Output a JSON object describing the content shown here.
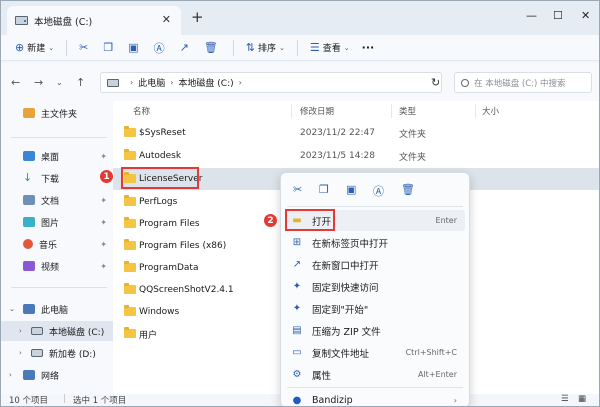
{
  "tab": {
    "title": "本地磁盘 (C:)",
    "close": "✕",
    "add": "+"
  },
  "window_controls": {
    "minimize": "—",
    "maximize": "☐",
    "close": "✕"
  },
  "toolbar": {
    "new_label": "新建",
    "sort_label": "排序",
    "view_label": "查看",
    "more_label": "···"
  },
  "address": {
    "seg1": "此电脑",
    "seg2": "本地磁盘 (C:)"
  },
  "search": {
    "placeholder": "在 本地磁盘 (C:) 中搜索"
  },
  "sidebar": {
    "home": "主文件夹",
    "desktop": "桌面",
    "downloads": "下载",
    "documents": "文档",
    "pictures": "图片",
    "music": "音乐",
    "videos": "视频",
    "this_pc": "此电脑",
    "local_c": "本地磁盘 (C:)",
    "new_d": "新加卷 (D:)",
    "network": "网络"
  },
  "columns": {
    "name": "名称",
    "modified": "修改日期",
    "type": "类型",
    "size": "大小"
  },
  "files": [
    {
      "name": "$SysReset",
      "date": "2023/11/2 22:47",
      "type": "文件夹"
    },
    {
      "name": "Autodesk",
      "date": "2023/11/5 14:28",
      "type": "文件夹"
    },
    {
      "name": "LicenseServer",
      "date": "",
      "type": ""
    },
    {
      "name": "PerfLogs",
      "date": "",
      "type": ""
    },
    {
      "name": "Program Files",
      "date": "",
      "type": ""
    },
    {
      "name": "Program Files (x86)",
      "date": "",
      "type": ""
    },
    {
      "name": "ProgramData",
      "date": "",
      "type": ""
    },
    {
      "name": "QQScreenShotV2.4.1",
      "date": "",
      "type": ""
    },
    {
      "name": "Windows",
      "date": "",
      "type": ""
    },
    {
      "name": "用户",
      "date": "",
      "type": ""
    }
  ],
  "status": {
    "count": "10 个项目",
    "selected": "选中 1 个项目"
  },
  "context_menu": {
    "open": "打开",
    "open_shortcut": "Enter",
    "open_new_tab": "在新标签页中打开",
    "open_new_window": "在新窗口中打开",
    "pin_quick": "固定到快速访问",
    "pin_start": "固定到\"开始\"",
    "zip": "压缩为 ZIP 文件",
    "copy_path": "复制文件地址",
    "copy_path_shortcut": "Ctrl+Shift+C",
    "properties": "属性",
    "properties_shortcut": "Alt+Enter",
    "bandizip": "Bandizip"
  },
  "badges": {
    "one": "1",
    "two": "2"
  },
  "colors": {
    "highlight": "#e53935",
    "folder": "#f4c542",
    "accent": "#2b5fb3"
  }
}
